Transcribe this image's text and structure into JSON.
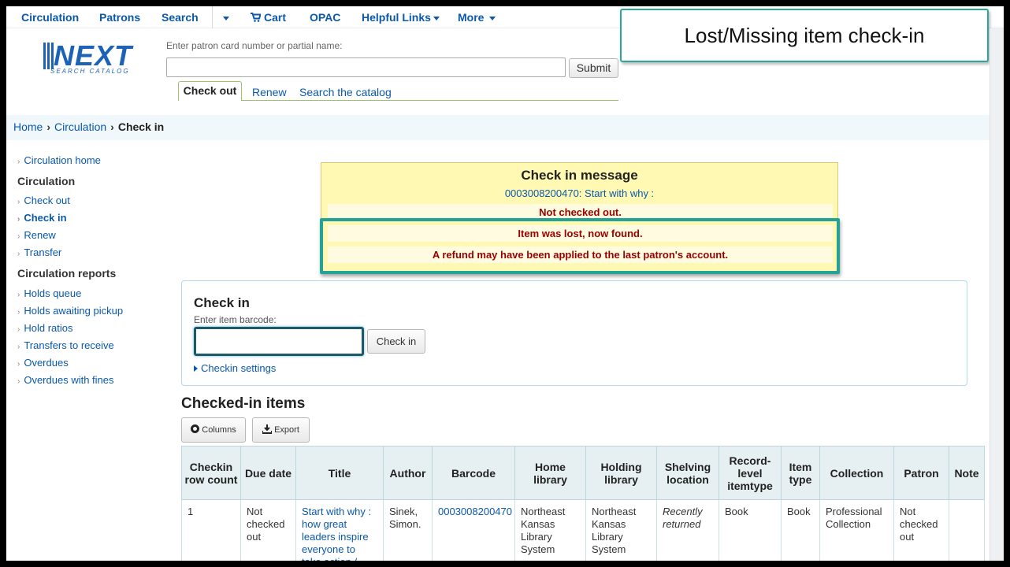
{
  "nav": {
    "items": [
      "Circulation",
      "Patrons",
      "Search",
      "Cart",
      "OPAC",
      "Helpful Links",
      "More"
    ]
  },
  "logo": {
    "word": "NEXT",
    "sub": "SEARCH CATALOG"
  },
  "patron_search": {
    "label": "Enter patron card number or partial name:",
    "value": "",
    "submit": "Submit"
  },
  "tabs": [
    "Check out",
    "Renew",
    "Search the catalog"
  ],
  "callout": {
    "text": "Lost/Missing item check-in"
  },
  "breadcrumb": [
    "Home",
    "Circulation",
    "Check in"
  ],
  "sidebar": {
    "home": "Circulation home",
    "section1": "Circulation",
    "section1_items": [
      "Check out",
      "Check in",
      "Renew",
      "Transfer"
    ],
    "section2": "Circulation reports",
    "section2_items": [
      "Holds queue",
      "Holds awaiting pickup",
      "Hold ratios",
      "Transfers to receive",
      "Overdues",
      "Overdues with fines"
    ]
  },
  "message": {
    "title": "Check in message",
    "item_link": "0003008200470: Start with why :",
    "rows": [
      "Not checked out.",
      "Item was lost, now found.",
      "A refund may have been applied to the last patron's account."
    ]
  },
  "checkin": {
    "title": "Check in",
    "barcode_label": "Enter item barcode:",
    "barcode_value": "",
    "button": "Check in",
    "settings": "Checkin settings"
  },
  "items": {
    "title": "Checked-in items",
    "columns_btn": "Columns",
    "export_btn": "Export",
    "headers": [
      "Checkin row count",
      "Due date",
      "Title",
      "Author",
      "Barcode",
      "Home library",
      "Holding library",
      "Shelving location",
      "Record-level itemtype",
      "Item type",
      "Collection",
      "Patron",
      "Note"
    ],
    "rows": [
      {
        "count": "1",
        "due": "Not checked out",
        "title": "Start with why : how great leaders inspire everyone to take action /",
        "author": "Sinek, Simon.",
        "barcode": "0003008200470",
        "home": "Northeast Kansas Library System",
        "holding": "Northeast Kansas Library System",
        "location": "Recently returned",
        "record_type": "Book",
        "item_type": "Book",
        "collection": "Professional Collection",
        "patron": "Not checked out",
        "note": ""
      }
    ]
  },
  "colors": {
    "link": "#0a58ac",
    "accent": "#23a396",
    "warning_bg": "#fff9b3",
    "alert_text": "#990000"
  }
}
